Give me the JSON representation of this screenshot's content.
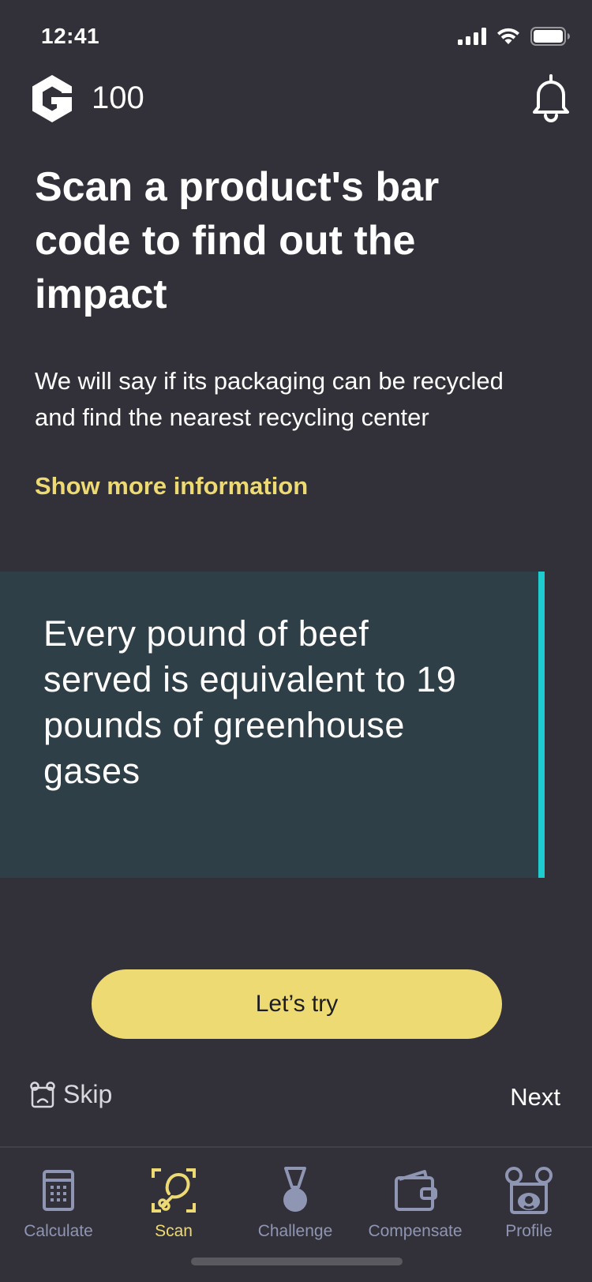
{
  "status_bar": {
    "time": "12:41"
  },
  "header": {
    "points": "100",
    "logo_icon": "hexagon-g-logo-icon",
    "bell_icon": "bell-icon"
  },
  "main": {
    "headline": "Scan a product's bar code to find out the impact",
    "description": "We will say if its packaging can be recycled and find the nearest recycling center",
    "show_more": "Show more information"
  },
  "fact_card": {
    "text": "Every pound of beef served is equivalent to 19 pounds of greenhouse gases"
  },
  "actions": {
    "cta": "Let’s try",
    "skip": "Skip",
    "next": "Next"
  },
  "tabbar": {
    "tabs": [
      {
        "label": "Calculate",
        "icon": "calculator-icon"
      },
      {
        "label": "Scan",
        "icon": "scan-drumstick-icon",
        "active": true
      },
      {
        "label": "Challenge",
        "icon": "medal-icon"
      },
      {
        "label": "Compensate",
        "icon": "wallet-icon"
      },
      {
        "label": "Profile",
        "icon": "bear-face-icon"
      }
    ]
  },
  "colors": {
    "background": "#323139",
    "accent": "#EEDA73",
    "card": "#2E3F47",
    "card_border": "#1ECCCF",
    "tab_inactive": "#8F96B4"
  }
}
